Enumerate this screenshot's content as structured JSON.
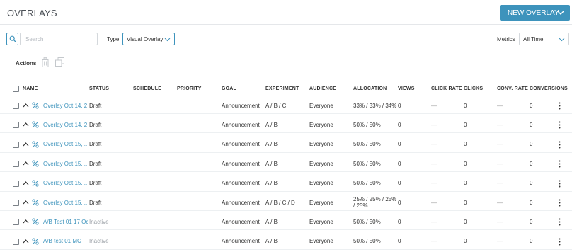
{
  "header": {
    "title": "OVERLAYS",
    "new_button_label": "NEW OVERLAY"
  },
  "colors": {
    "accent": "#3d93bc",
    "link": "#3d93bc",
    "muted": "#9aa0a6"
  },
  "filters": {
    "search_placeholder": "Search",
    "search_value": "",
    "type_label": "Type",
    "type_value": "Visual Overlay",
    "metrics_label": "Metrics",
    "metrics_value": "All Time"
  },
  "actions": {
    "label": "Actions",
    "icons": [
      "trash-icon",
      "copy-icon"
    ]
  },
  "table": {
    "columns": {
      "name": "NAME",
      "status": "STATUS",
      "schedule": "SCHEDULE",
      "priority": "PRIORITY",
      "goal": "GOAL",
      "experiment": "EXPERIMENT",
      "audience": "AUDIENCE",
      "allocation": "ALLOCATION",
      "views": "VIEWS",
      "click_rate": "CLICK RATE",
      "clicks": "CLICKS",
      "conv_rate": "CONV. RATE",
      "conversions": "CONVERSIONS"
    },
    "rows": [
      {
        "name": "Overlay Oct 14, 2...",
        "status": "Draft",
        "schedule": "",
        "priority": "",
        "goal": "Announcement",
        "experiment": "A / B / C",
        "audience": "Everyone",
        "allocation": "33% / 33% / 34%",
        "views": "0",
        "click_rate": "—",
        "clicks": "0",
        "conv_rate": "—",
        "conversions": "0"
      },
      {
        "name": "Overlay Oct 14, 2...",
        "status": "Draft",
        "schedule": "",
        "priority": "",
        "goal": "Announcement",
        "experiment": "A / B",
        "audience": "Everyone",
        "allocation": "50% / 50%",
        "views": "0",
        "click_rate": "—",
        "clicks": "0",
        "conv_rate": "—",
        "conversions": "0"
      },
      {
        "name": "Overlay Oct 15, ...",
        "status": "Draft",
        "schedule": "",
        "priority": "",
        "goal": "Announcement",
        "experiment": "A / B",
        "audience": "Everyone",
        "allocation": "50% / 50%",
        "views": "0",
        "click_rate": "—",
        "clicks": "0",
        "conv_rate": "—",
        "conversions": "0"
      },
      {
        "name": "Overlay Oct 15, ...",
        "status": "Draft",
        "schedule": "",
        "priority": "",
        "goal": "Announcement",
        "experiment": "A / B",
        "audience": "Everyone",
        "allocation": "50% / 50%",
        "views": "0",
        "click_rate": "—",
        "clicks": "0",
        "conv_rate": "—",
        "conversions": "0"
      },
      {
        "name": "Overlay Oct 15, ...",
        "status": "Draft",
        "schedule": "",
        "priority": "",
        "goal": "Announcement",
        "experiment": "A / B",
        "audience": "Everyone",
        "allocation": "50% / 50%",
        "views": "0",
        "click_rate": "—",
        "clicks": "0",
        "conv_rate": "—",
        "conversions": "0"
      },
      {
        "name": "Overlay Oct 15, ...",
        "status": "Draft",
        "schedule": "",
        "priority": "",
        "goal": "Announcement",
        "experiment": "A / B / C / D",
        "audience": "Everyone",
        "allocation": "25% / 25% / 25% / 25%",
        "views": "0",
        "click_rate": "—",
        "clicks": "0",
        "conv_rate": "—",
        "conversions": "0"
      },
      {
        "name": "A/B Test 01 17 Oct",
        "status": "Inactive",
        "schedule": "",
        "priority": "",
        "goal": "Announcement",
        "experiment": "A / B",
        "audience": "Everyone",
        "allocation": "50% / 50%",
        "views": "0",
        "click_rate": "—",
        "clicks": "0",
        "conv_rate": "—",
        "conversions": "0"
      },
      {
        "name": "A/B test 01 MC",
        "status": "Inactive",
        "schedule": "",
        "priority": "",
        "goal": "Announcement",
        "experiment": "A / B",
        "audience": "Everyone",
        "allocation": "50% / 50%",
        "views": "0",
        "click_rate": "—",
        "clicks": "0",
        "conv_rate": "—",
        "conversions": "0"
      }
    ]
  }
}
